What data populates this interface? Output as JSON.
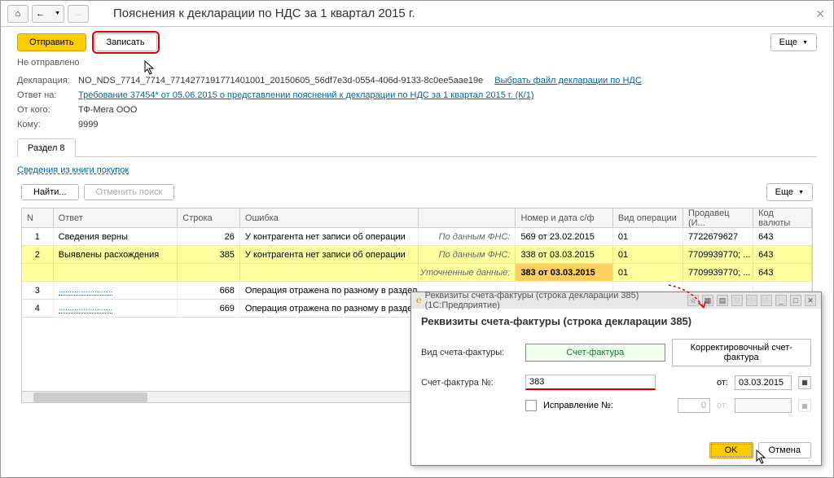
{
  "title": "Пояснения к декларации по НДС за 1 квартал 2015 г.",
  "toolbar": {
    "send": "Отправить",
    "write": "Записать",
    "more": "Еще"
  },
  "status": "Не отправлено",
  "info": {
    "decl_label": "Декларация:",
    "decl_value": "NO_NDS_7714_7714_7714277191771401001_20150605_56df7e3d-0554-406d-9133-8c0ee5aae19e",
    "decl_link": "Выбрать файл декларации по НДС",
    "response_label": "Ответ на:",
    "response_link": "Требование 37454* от 05.06.2015 о представлении пояснений к декларации по НДС за 1 квартал 2015 г. (К/1)",
    "from_label": "От кого:",
    "from_value": "ТФ-Мега ООО",
    "to_label": "Кому:",
    "to_value": "9999"
  },
  "tab": "Раздел 8",
  "book_link": "Сведения из книги покупок",
  "filter": {
    "find": "Найти...",
    "cancel": "Отменить поиск",
    "more": "Еще"
  },
  "cols": {
    "n": "N",
    "answer": "Ответ",
    "line": "Строка",
    "error": "Ошибка",
    "nd": "Номер и дата с/ф",
    "op": "Вид операции",
    "seller": "Продавец (И...",
    "curr": "Код валюты"
  },
  "rows": [
    {
      "n": "1",
      "answer": "Сведения верны",
      "line": "26",
      "error": "У контрагента нет записи об операции",
      "src": "По данным ФНС:",
      "nd": "569 от 23.02.2015",
      "op": "01",
      "seller": "7722679627",
      "curr": "643"
    },
    {
      "n": "2",
      "answer": "Выявлены расхождения",
      "line": "385",
      "error": "У контрагента нет записи об операции",
      "src": "По данным ФНС:",
      "nd": "338 от 03.03.2015",
      "op": "01",
      "seller": "7709939770; ...",
      "curr": "643"
    },
    {
      "src2": "Уточненные данные:",
      "nd2": "383 от 03.03.2015",
      "op2": "01",
      "seller2": "7709939770; ...",
      "curr2": "643"
    },
    {
      "n": "3",
      "answer": "........................",
      "line": "668",
      "error": "Операция отражена по разному в разделах 8 и 9"
    },
    {
      "n": "4",
      "answer": "........................",
      "line": "669",
      "error": "Операция отражена по разному в разделах 8 и 9"
    }
  ],
  "dialog": {
    "window_title": "Реквизиты счета-фактуры (строка декларации 385)  (1С:Предприятие)",
    "header": "Реквизиты счета-фактуры (строка декларации 385)",
    "type_label": "Вид счета-фактуры:",
    "type_sf": "Счет-фактура",
    "type_corr": "Корректировочный счет-фактура",
    "num_label": "Счет-фактура №:",
    "num_value": "383",
    "from_label": "от:",
    "date_value": "03.03.2015",
    "fix_label": "Исправление №:",
    "fix_num": "0",
    "fix_from": "от:",
    "ok": "OK",
    "cancel": "Отмена"
  }
}
